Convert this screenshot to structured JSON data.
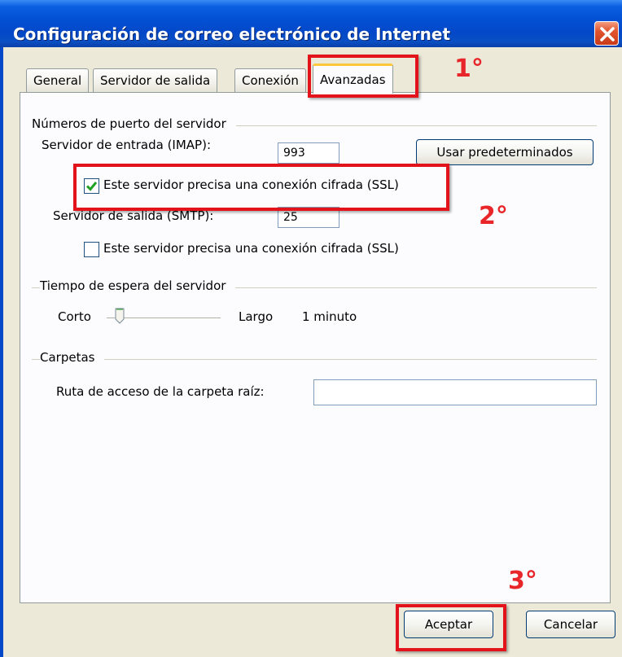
{
  "window": {
    "title": "Configuración de correo electrónico de Internet"
  },
  "tabs": [
    {
      "label": "General"
    },
    {
      "label": "Servidor de salida"
    },
    {
      "label": "Conexión"
    },
    {
      "label": "Avanzadas"
    }
  ],
  "ports_section": {
    "title": "Números de puerto del servidor",
    "incoming_label": "Servidor de entrada (IMAP):",
    "incoming_value": "993",
    "defaults_button": "Usar predeterminados",
    "incoming_ssl_label": "Este servidor precisa una conexión cifrada (SSL)",
    "incoming_ssl_checked": true,
    "outgoing_label": "Servidor de salida (SMTP):",
    "outgoing_value": "25",
    "outgoing_ssl_label": "Este servidor precisa una conexión cifrada (SSL)",
    "outgoing_ssl_checked": false
  },
  "timeout_section": {
    "title": "Tiempo de espera del servidor",
    "short_label": "Corto",
    "long_label": "Largo",
    "value": "1 minuto",
    "slider_level": 0.1
  },
  "folders_section": {
    "title": "Carpetas",
    "root_path_label": "Ruta de acceso de la carpeta raíz:",
    "root_path_value": ""
  },
  "buttons": {
    "ok": "Aceptar",
    "cancel": "Cancelar"
  },
  "annotations": {
    "step1": "1°",
    "step2": "2°",
    "step3": "3°",
    "color": "#e3131b"
  }
}
